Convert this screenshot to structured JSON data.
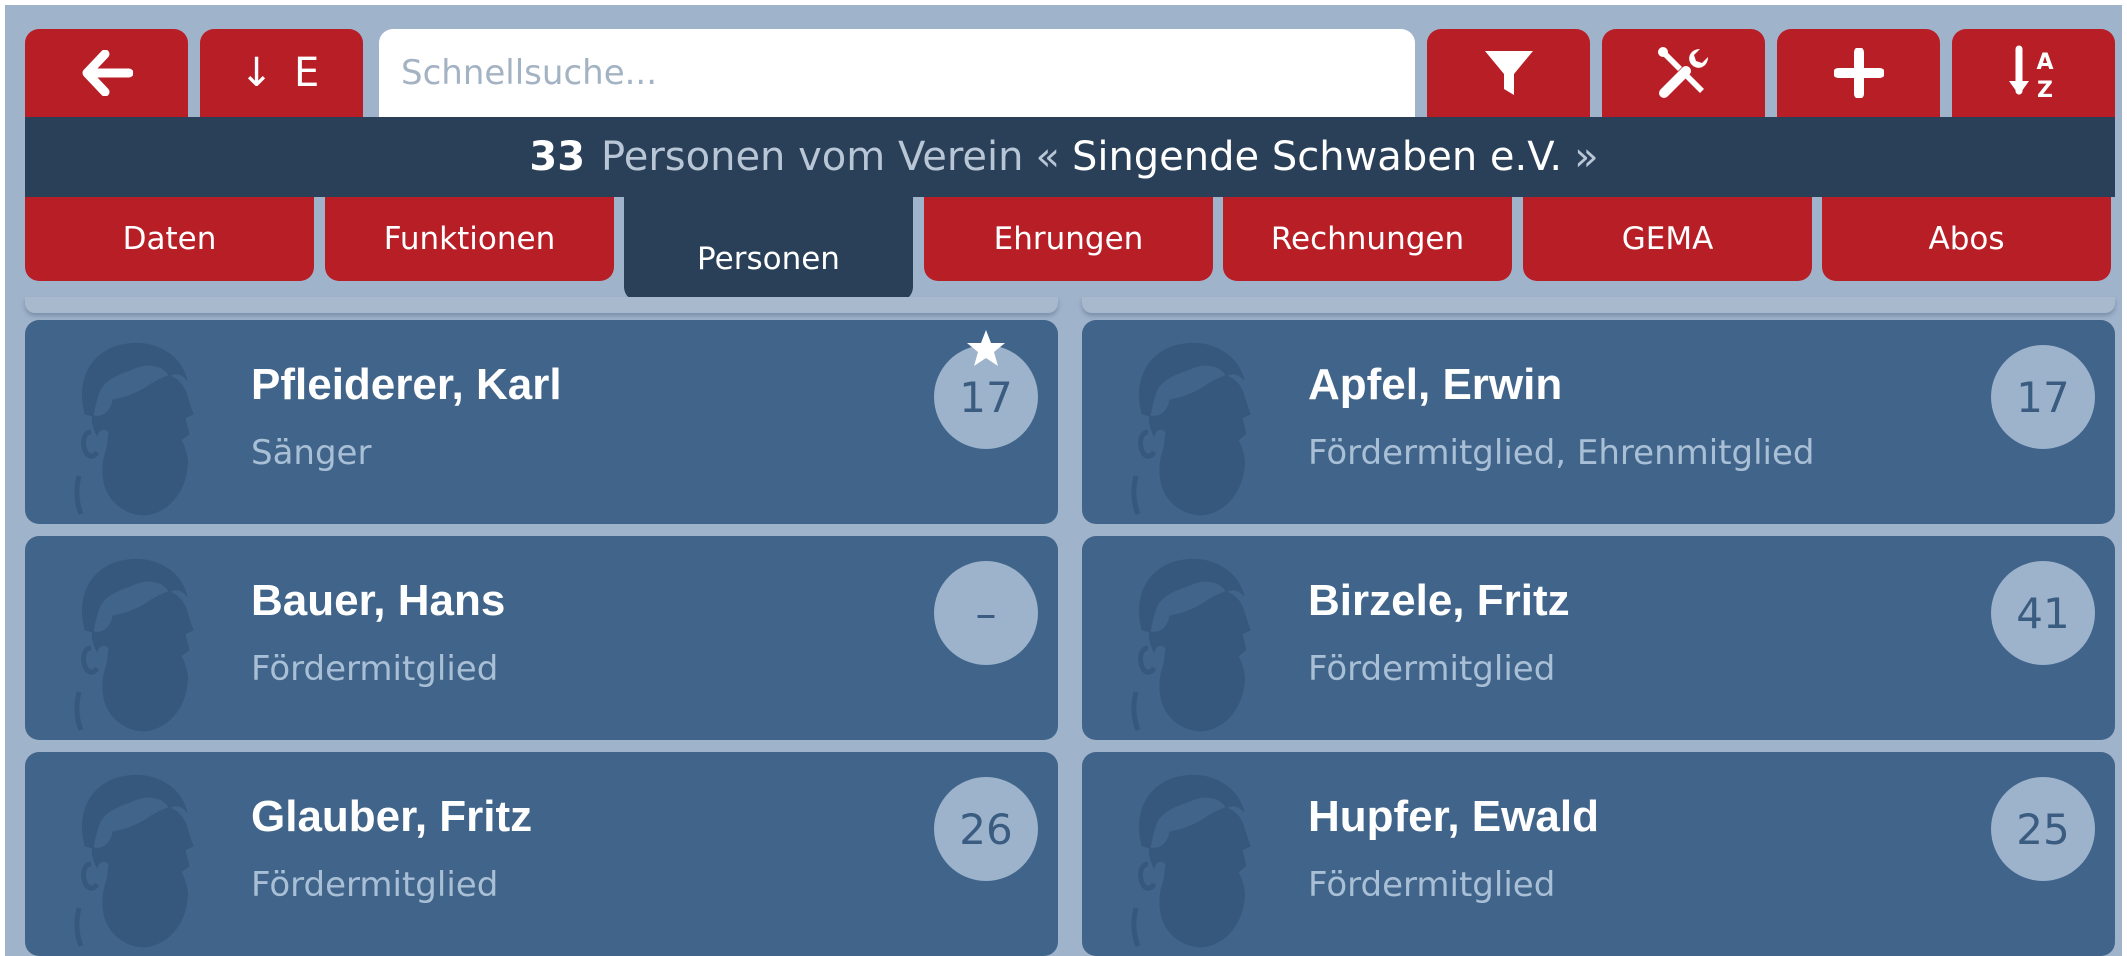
{
  "toolbar": {
    "back_icon": "arrow-left-icon",
    "sort_e_label": "↓ E",
    "search_placeholder": "Schnellsuche...",
    "filter_icon": "filter-icon",
    "tools_icon": "tools-icon",
    "add_icon": "plus-icon",
    "sort_az_icon": "sort-alpha-icon"
  },
  "header": {
    "count": "33",
    "text": "Personen vom Verein",
    "open_quote": "«",
    "club": "Singende Schwaben e.V.",
    "close_quote": "»"
  },
  "tabs": [
    {
      "label": "Daten"
    },
    {
      "label": "Funktionen"
    },
    {
      "label": "Personen",
      "active": true
    },
    {
      "label": "Ehrungen"
    },
    {
      "label": "Rechnungen"
    },
    {
      "label": "GEMA"
    },
    {
      "label": "Abos"
    }
  ],
  "people": [
    {
      "name": "Pfleiderer, Karl",
      "role": "Sänger",
      "badge": "17",
      "starred": true
    },
    {
      "name": "Apfel, Erwin",
      "role": "Fördermitglied, Ehrenmitglied",
      "badge": "17"
    },
    {
      "name": "Bauer, Hans",
      "role": "Fördermitglied",
      "badge": "–"
    },
    {
      "name": "Birzele, Fritz",
      "role": "Fördermitglied",
      "badge": "41"
    },
    {
      "name": "Glauber, Fritz",
      "role": "Fördermitglied",
      "badge": "26"
    },
    {
      "name": "Hupfer, Ewald",
      "role": "Fördermitglied",
      "badge": "25"
    }
  ],
  "colors": {
    "accent_red": "#b81e26",
    "navy": "#2a4058",
    "card": "#41658a",
    "background": "#9fb3cb"
  }
}
